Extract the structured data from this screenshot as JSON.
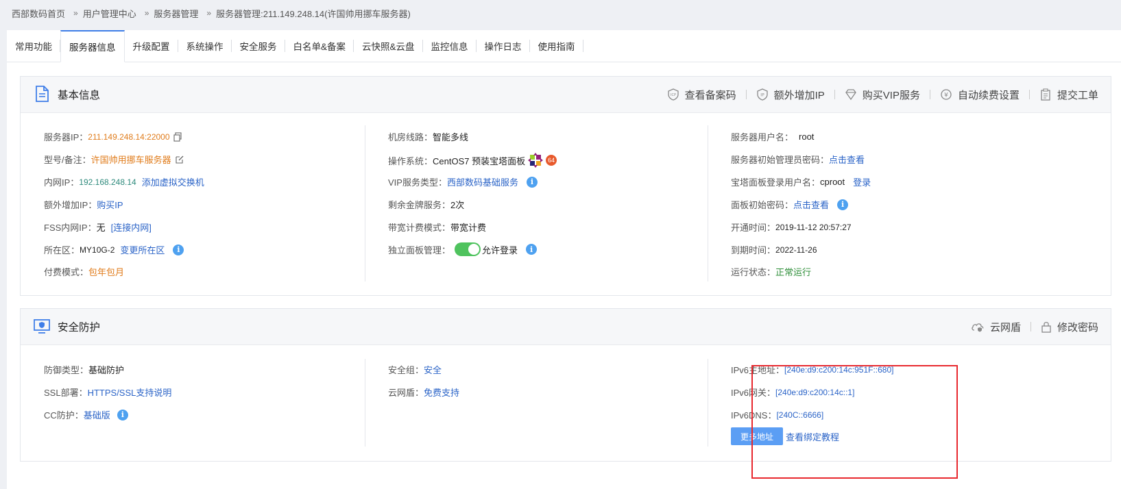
{
  "breadcrumb": {
    "items": [
      "西部数码首页",
      "用户管理中心",
      "服务器管理",
      "服务器管理:211.149.248.14(许国帅用挪车服务器)"
    ],
    "separator": "»"
  },
  "tabs": [
    {
      "label": "常用功能"
    },
    {
      "label": "服务器信息",
      "active": true
    },
    {
      "label": "升级配置"
    },
    {
      "label": "系统操作"
    },
    {
      "label": "安全服务"
    },
    {
      "label": "白名单&备案"
    },
    {
      "label": "云快照&云盘"
    },
    {
      "label": "监控信息"
    },
    {
      "label": "操作日志"
    },
    {
      "label": "使用指南"
    }
  ],
  "basic": {
    "title": "基本信息",
    "actions": {
      "view_record": "查看备案码",
      "add_ip": "额外增加IP",
      "buy_vip": "购买VIP服务",
      "auto_renew": "自动续费设置",
      "submit_ticket": "提交工单"
    },
    "col1": {
      "server_ip_label": "服务器IP：",
      "server_ip_value": "211.149.248.14:22000",
      "model_label": "型号/备注：",
      "model_value": "许国帅用挪车服务器",
      "lan_ip_label": "内网IP：",
      "lan_ip_value": "192.168.248.14",
      "lan_ip_link": "添加虚拟交换机",
      "extra_ip_label": "额外增加IP：",
      "extra_ip_link": "购买IP",
      "fss_label": "FSS内网IP：",
      "fss_value": "无",
      "fss_link": "[连接内网]",
      "region_label": "所在区：",
      "region_value": "MY10G-2",
      "region_link": "变更所在区",
      "pay_label": "付费模式：",
      "pay_value": "包年包月"
    },
    "col2": {
      "line_label": "机房线路：",
      "line_value": "智能多线",
      "os_label": "操作系统：",
      "os_value": "CentOS7 预装宝塔面板",
      "os_badge": "64",
      "vip_label": "VIP服务类型：",
      "vip_link": "西部数码基础服务",
      "gold_label": "剩余金牌服务：",
      "gold_value": "2次",
      "bw_label": "带宽计费模式：",
      "bw_value": "带宽计费",
      "panel_label": "独立面板管理：",
      "panel_value": "允许登录",
      "panel_enabled": true
    },
    "col3": {
      "user_label": "服务器用户名：",
      "user_value": "root",
      "init_pwd_label": "服务器初始管理员密码：",
      "init_pwd_link": "点击查看",
      "bt_user_label": "宝塔面板登录用户名：",
      "bt_user_value": "cproot",
      "bt_login_link": "登录",
      "panel_pwd_label": "面板初始密码：",
      "panel_pwd_link": "点击查看",
      "open_label": "开通时间：",
      "open_value": "2019-11-12 20:57:27",
      "expire_label": "到期时间：",
      "expire_value": "2022-11-26",
      "status_label": "运行状态：",
      "status_value": "正常运行"
    }
  },
  "security": {
    "title": "安全防护",
    "actions": {
      "cloud_shield": "云网盾",
      "change_pwd": "修改密码"
    },
    "col1": {
      "defense_label": "防御类型：",
      "defense_value": "基础防护",
      "ssl_label": "SSL部署：",
      "ssl_link": "HTTPS/SSL支持说明",
      "cc_label": "CC防护：",
      "cc_link": "基础版"
    },
    "col2": {
      "sg_label": "安全组：",
      "sg_link": "安全",
      "shield_label": "云网盾：",
      "shield_link": "免费支持"
    },
    "col3": {
      "ipv6_main_label": "IPv6主地址：",
      "ipv6_main_value": "[240e:d9:c200:14c:951F::680]",
      "ipv6_gw_label": "IPv6网关：",
      "ipv6_gw_value": "[240e:d9:c200:14c::1]",
      "ipv6_dns_label": "IPv6DNS：",
      "ipv6_dns_value": "[240C::6666]",
      "more_button": "更多地址",
      "tutorial_link": "查看绑定教程"
    }
  },
  "colors": {
    "accent": "#3f7ee8",
    "link": "#2a63c7",
    "orange": "#e07b1a",
    "green": "#2f8f3a",
    "toggle_on": "#4fc35e",
    "highlight": "#e8282e"
  }
}
